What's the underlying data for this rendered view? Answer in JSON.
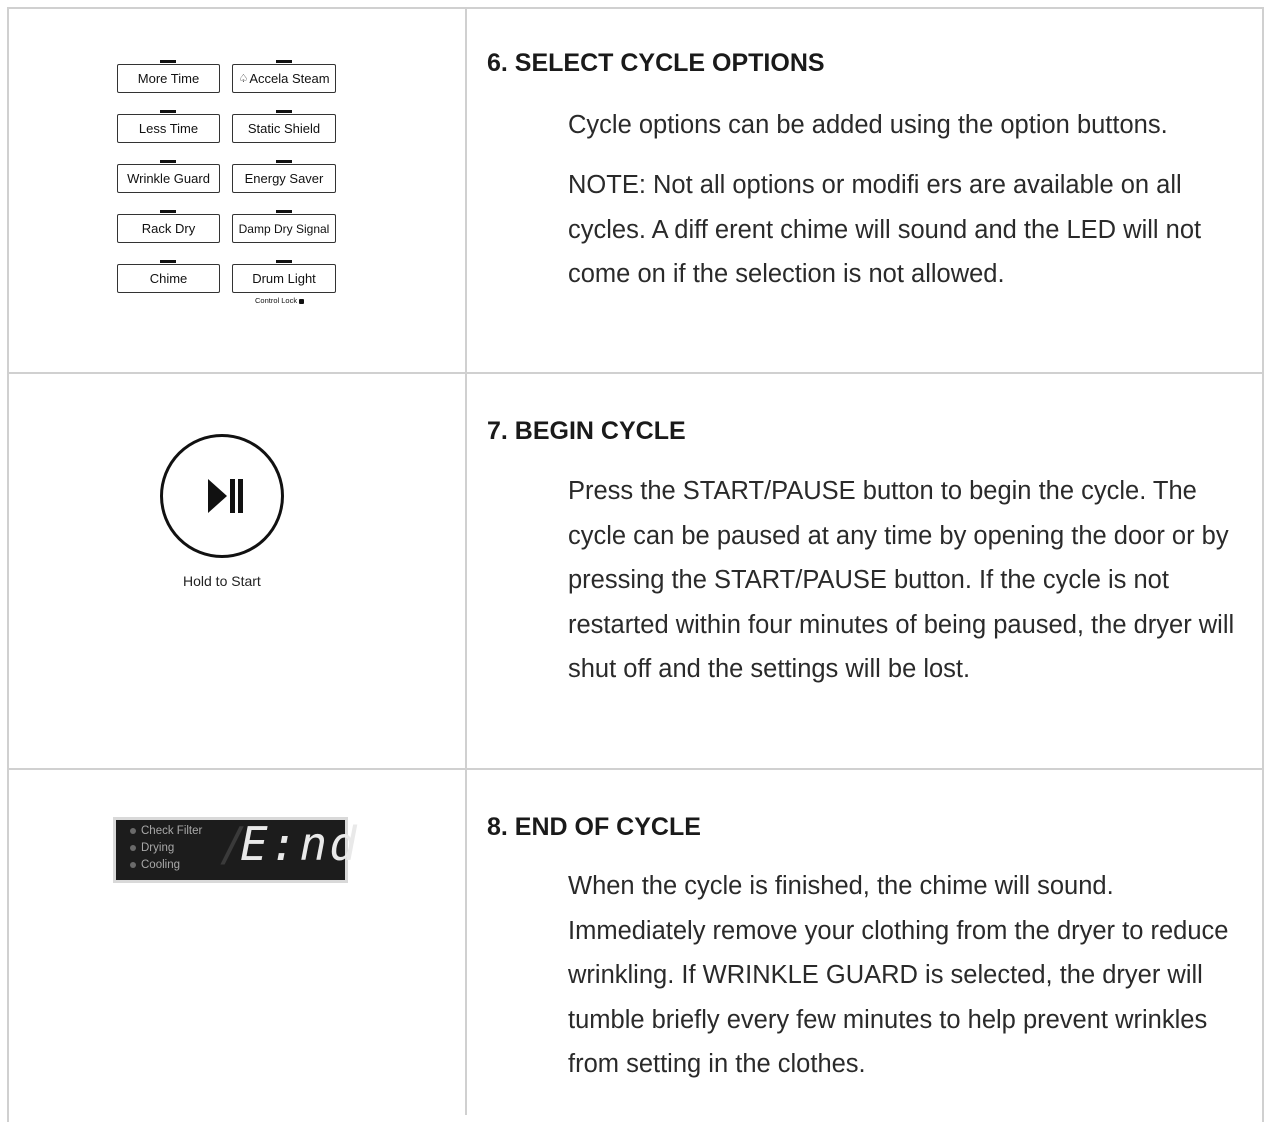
{
  "options_panel": {
    "buttons": [
      {
        "label": "More Time"
      },
      {
        "label": "Accela Steam"
      },
      {
        "label": "Less Time"
      },
      {
        "label": "Static Shield"
      },
      {
        "label": "Wrinkle Guard"
      },
      {
        "label": "Energy Saver"
      },
      {
        "label": "Rack Dry"
      },
      {
        "label": "Damp Dry Signal"
      },
      {
        "label": "Chime"
      },
      {
        "label": "Drum Light"
      }
    ],
    "control_lock_label": "Control Lock"
  },
  "start_panel": {
    "hold_label": "Hold to Start"
  },
  "display_panel": {
    "indicators": [
      "Check Filter",
      "Drying",
      "Cooling"
    ],
    "readout": "E:nd"
  },
  "steps": [
    {
      "title": "6. SELECT CYCLE OPTIONS",
      "paragraphs": [
        "Cycle options can be added using the option buttons.",
        "NOTE: Not all options or modifi ers are available on all cycles. A diff erent chime will sound and the LED will not come on if the selection is not allowed."
      ]
    },
    {
      "title": "7. BEGIN CYCLE",
      "paragraphs": [
        "Press the START/PAUSE button to begin the cycle. The cycle can be paused at any time by opening the door or by pressing the START/PAUSE button. If the cycle is not restarted within four minutes of being paused, the dryer will shut off and the settings will be lost."
      ]
    },
    {
      "title": "8. END OF CYCLE",
      "paragraphs": [
        "When the cycle is finished, the chime will sound. Immediately remove your clothing from the dryer to reduce wrinkling. If WRINKLE GUARD is selected, the dryer will tumble briefly every few minutes to help prevent wrinkles from setting in the clothes."
      ]
    }
  ]
}
